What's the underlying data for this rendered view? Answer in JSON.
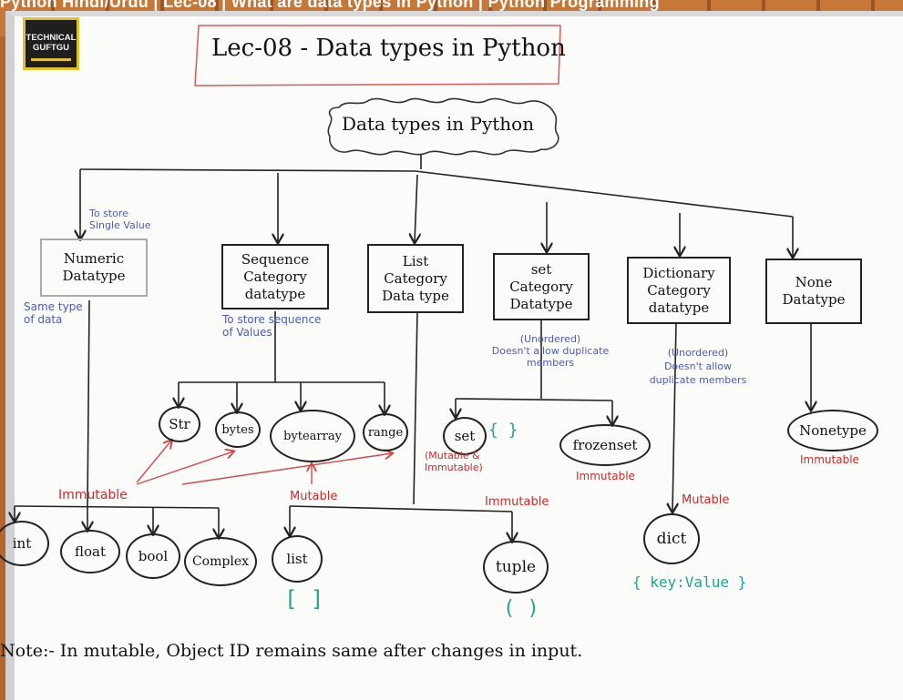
{
  "video_title": "Python Hindi/Urdu | Lec-08 | What are data types in Python | Python Programming",
  "logo": {
    "line1": "TECHNICAL",
    "line2": "GUFTGU"
  },
  "heading": "Lec-08 - Data types in Python",
  "root": "Data types in Python",
  "categories": {
    "numeric": "Numeric\nDatatype",
    "sequence": "Sequence\nCategory\ndatatype",
    "list": "List\nCategory\nData type",
    "set": "set\nCategory\nDatatype",
    "dictionary": "Dictionary\nCategory\ndatatype",
    "none": "None\nDatatype"
  },
  "notes": {
    "to_store_single": "To store\nSingle Value",
    "same_type": "Same type\nof data",
    "to_store_sequence": "To store   sequence\nof           Values",
    "set_unordered": "(Unordered)\nDoesn't allow duplicate\nmembers",
    "dict_unordered": "(Unordered)\nDoesn't allow\nduplicate members"
  },
  "types": {
    "str": "Str",
    "bytes": "bytes",
    "bytearray": "bytearray",
    "range": "range",
    "set": "set",
    "frozenset": "frozenset",
    "nonetype": "Nonetype",
    "int": "int",
    "float": "float",
    "bool": "bool",
    "complex": "Complex",
    "list": "list",
    "tuple": "tuple",
    "dict": "dict"
  },
  "labels": {
    "immutable_numeric": "Immutable",
    "mutable_list": "Mutable",
    "immutable_tuple": "Immutable",
    "set_both": "(Mutable &\nImmutable)",
    "frozenset_immutable": "Immutable",
    "dict_mutable": "Mutable",
    "none_immutable": "Immutable"
  },
  "symbols": {
    "set_braces": "{ }",
    "list_brackets": "[ ]",
    "tuple_parens": "( )",
    "dict_kv": "{ key:Value }"
  },
  "note": "Note:- In mutable, Object ID remains same after changes in input."
}
